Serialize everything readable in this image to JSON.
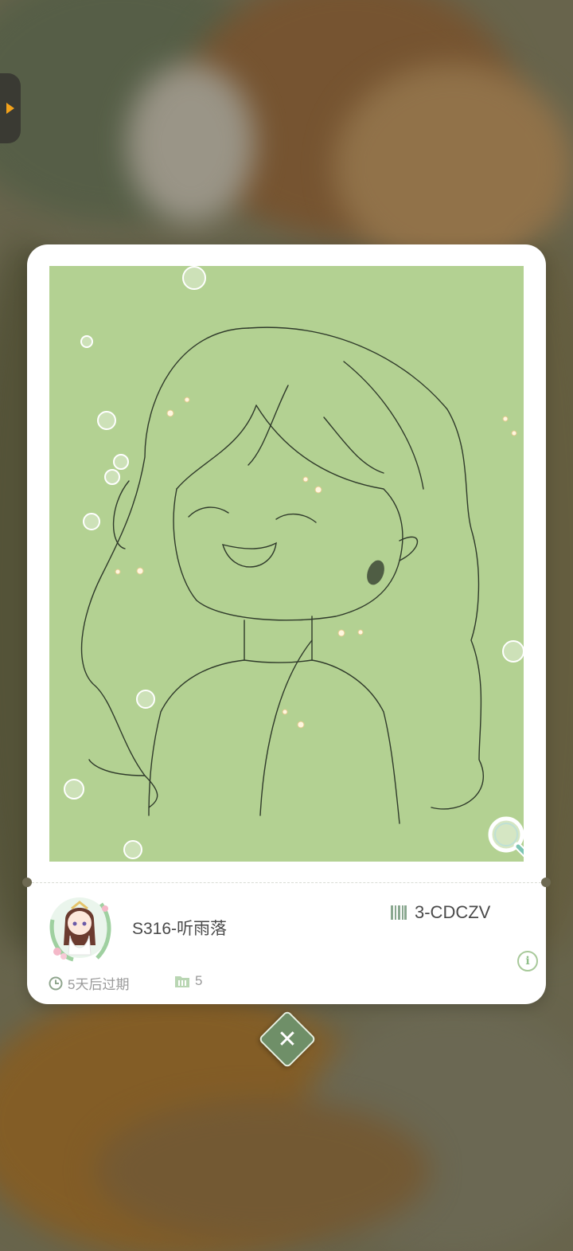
{
  "card": {
    "title": "S316-听雨落",
    "code": "3-CDCZV",
    "expire_text": "5天后过期",
    "count": "5",
    "info_label": "i"
  },
  "icons": {
    "side_tab": "play-arrow-icon",
    "code": "barcode-icon",
    "expire": "clock-icon",
    "count": "folder-icon",
    "info": "info-icon",
    "zoom": "magnifier-icon",
    "close": "close-icon"
  },
  "close_button": {
    "label": "✕"
  },
  "colors": {
    "artwork_bg": "#b3d192",
    "accent_green": "#6f8f68",
    "side_tab_arrow": "#f2a21b"
  }
}
